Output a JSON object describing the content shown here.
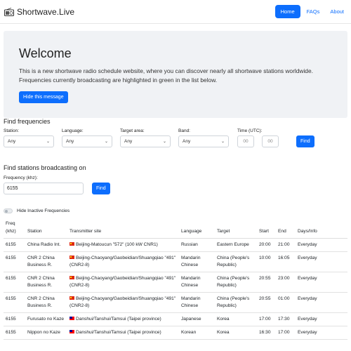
{
  "nav": {
    "brand": "Shortwave.Live",
    "links": [
      "Home",
      "FAQs",
      "About"
    ]
  },
  "welcome": {
    "title": "Welcome",
    "text": "This is a new shortwave radio schedule website, where you can discover nearly all shortwave stations worldwide. Frequencies currently broadcasting are highlighted in green in the list below.",
    "hide_button": "Hide this message"
  },
  "find_frequencies": {
    "title": "Find frequencies",
    "station_label": "Station:",
    "station_value": "Any",
    "language_label": "Language:",
    "language_value": "Any",
    "target_label": "Target area:",
    "target_value": "Any",
    "band_label": "Band:",
    "band_value": "Any",
    "time_label": "Time (UTC):",
    "time_from_placeholder": "00",
    "time_to_placeholder": "00",
    "find_button": "Find"
  },
  "find_stations": {
    "title": "Find stations broadcasting on",
    "freq_label": "Frequency (khz):",
    "freq_value": "6155",
    "find_button": "Find"
  },
  "toggle_label": "Hide Inactive Frequencies",
  "table": {
    "headers": [
      "Freq (khz)",
      "Station",
      "Transmitter site",
      "Language",
      "Target",
      "Start",
      "End",
      "Days/Info"
    ],
    "rows": [
      {
        "freq": "6155",
        "station": "China Radio Int.",
        "flag": "cn",
        "site": "Beijing-Matoucun \"572\" (100 kW CNR1)",
        "language": "Russian",
        "target": "Eastern Europe",
        "start": "20:00",
        "end": "21:00",
        "days": "Everyday"
      },
      {
        "freq": "6155",
        "station": "CNR 2 China Business R.",
        "flag": "cn",
        "site": "Beijing-Chaoyang/Gaobeidian/Shuangqiao \"491\" (CNR2-8)",
        "language": "Mandarin Chinese",
        "target": "China (People's Republic)",
        "start": "10:00",
        "end": "16:05",
        "days": "Everyday"
      },
      {
        "freq": "6155",
        "station": "CNR 2 China Business R.",
        "flag": "cn",
        "site": "Beijing-Chaoyang/Gaobeidian/Shuangqiao \"491\" (CNR2-8)",
        "language": "Mandarin Chinese",
        "target": "China (People's Republic)",
        "start": "20:55",
        "end": "23:00",
        "days": "Everyday"
      },
      {
        "freq": "6155",
        "station": "CNR 2 China Business R.",
        "flag": "cn",
        "site": "Beijing-Chaoyang/Gaobeidian/Shuangqiao \"491\" (CNR2-8)",
        "language": "Mandarin Chinese",
        "target": "China (People's Republic)",
        "start": "20:55",
        "end": "01:00",
        "days": "Everyday"
      },
      {
        "freq": "6155",
        "station": "Furusato no Kaze",
        "flag": "tw",
        "site": "Danshui/Tanshui/Tamsui (Taipei province)",
        "language": "Japanese",
        "target": "Korea",
        "start": "17:00",
        "end": "17:30",
        "days": "Everyday"
      },
      {
        "freq": "6155",
        "station": "Nippon no Kaze",
        "flag": "tw",
        "site": "Danshui/Tanshui/Tamsui (Taipei province)",
        "language": "Korean",
        "target": "Korea",
        "start": "16:30",
        "end": "17:00",
        "days": "Everyday"
      }
    ]
  }
}
